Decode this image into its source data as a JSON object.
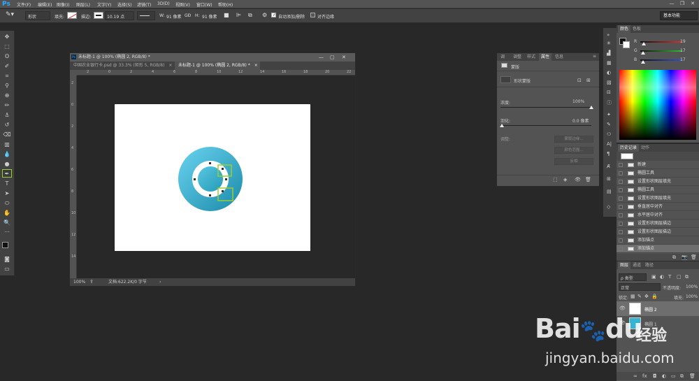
{
  "app": {
    "logo": "Ps"
  },
  "menubar": {
    "items": [
      "文件(F)",
      "编辑(E)",
      "图像(I)",
      "图层(L)",
      "文字(Y)",
      "选择(S)",
      "滤镜(T)",
      "3D(D)",
      "视图(V)",
      "窗口(W)",
      "帮助(H)"
    ],
    "window_controls": [
      "—",
      "❐",
      "✕"
    ]
  },
  "options": {
    "mode": "形状",
    "fill_label": "填充:",
    "stroke_label": "描边:",
    "stroke_size": "10.19 点",
    "w_label": "W:",
    "w_value": "91 像素",
    "link_label": "GĐ",
    "h_label": "H:",
    "h_value": "91 像素",
    "auto_add_delete": "自动添加/删除",
    "align_edges": "对齐边缘",
    "workspace": "基本功能"
  },
  "document": {
    "window_title": "未标题-1 @ 100% (椭圆 2, RGB/8) *",
    "tabs": [
      {
        "label": "中国农业银行卡.psd @ 33.3% (矩形 5, RGB/8)",
        "close": "×",
        "active": false
      },
      {
        "label": "未标题-1 @ 100% (椭圆 2, RGB/8) *",
        "close": "×",
        "active": true
      }
    ],
    "zoom": "100%",
    "status": "文档:622.2K/0 字节",
    "ruler_h": [
      "2",
      "0",
      "2",
      "4",
      "6",
      "8",
      "10",
      "12",
      "14",
      "16",
      "18",
      "20",
      "22"
    ],
    "ruler_v": [
      "2",
      "0",
      "2",
      "4",
      "6",
      "8",
      "10",
      "12",
      "14"
    ]
  },
  "properties": {
    "tabs": [
      "调",
      "调整",
      "样式",
      "属性",
      "信息"
    ],
    "active_tab": "属性",
    "header": "蒙版",
    "shape_label": "形状蒙版",
    "density_label": "浓度:",
    "density_value": "100%",
    "density_level": 1.0,
    "feather_label": "羽化:",
    "feather_value": "0.0 像素",
    "refine_label": "调整:",
    "buttons": [
      "蒙版边缘...",
      "颜色范围...",
      "反相"
    ]
  },
  "color": {
    "tabs": [
      "颜色",
      "色板"
    ],
    "channels": [
      {
        "name": "R",
        "value": "19",
        "color": "#e03030",
        "level": 0.075
      },
      {
        "name": "G",
        "value": "17",
        "color": "#30c030",
        "level": 0.067
      },
      {
        "name": "B",
        "value": "17",
        "color": "#3050e0",
        "level": 0.067
      }
    ],
    "foreground": "#131111"
  },
  "history": {
    "tabs": [
      "历史记录",
      "动作"
    ],
    "items": [
      "新建",
      "椭圆工具",
      "设置形状图层填充",
      "椭圆工具",
      "设置形状图层填充",
      "垂直居中对齐",
      "水平居中对齐",
      "设置形状图层描边",
      "设置形状图层描边",
      "添加锚点",
      "添加锚点"
    ],
    "selected_index": 10
  },
  "layers": {
    "tabs": [
      "图层",
      "通道",
      "路径"
    ],
    "filter": "ρ 类型",
    "blend_mode": "正常",
    "opacity_label": "不透明度:",
    "opacity_value": "100%",
    "lock_label": "锁定:",
    "fill_label": "填充:",
    "fill_value": "100%",
    "items": [
      {
        "name": "椭圆 2",
        "selected": true
      },
      {
        "name": "椭圆 1",
        "selected": false
      }
    ]
  },
  "colors": {
    "accent": "#9acd32",
    "ps_blue": "#31a8ff",
    "ring_dark": "#1f93b0",
    "ring_light": "#5fd0ee"
  },
  "watermark": {
    "brand": "Bai",
    "brand2": "du",
    "cn": "经验",
    "url": "jingyan.baidu.com"
  }
}
